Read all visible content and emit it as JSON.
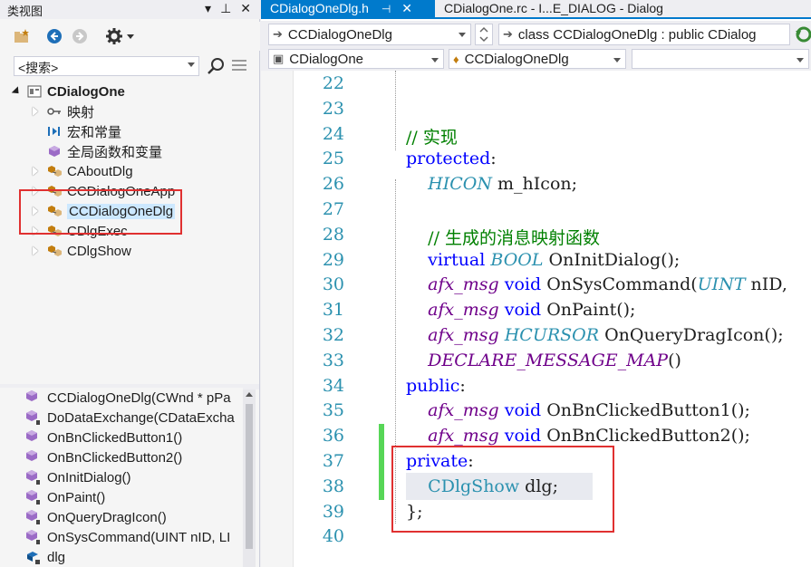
{
  "left_panel": {
    "title": "类视图",
    "title_buttons": {
      "dropdown": "▾",
      "pin": "⊥",
      "close": "✕"
    },
    "search": {
      "placeholder": "<搜索>"
    },
    "tree": [
      {
        "label": "CDialogOne",
        "bold": true,
        "icon": "project-icon",
        "expander": "open"
      },
      {
        "label": "映射",
        "icon": "key-icon",
        "expander": "closed"
      },
      {
        "label": "宏和常量",
        "icon": "macro-icon",
        "expander": ""
      },
      {
        "label": "全局函数和变量",
        "icon": "global-icon",
        "expander": ""
      },
      {
        "label": "CAboutDlg",
        "icon": "class-icon",
        "expander": "closed"
      },
      {
        "label": "CCDialogOneApp",
        "icon": "class-icon",
        "expander": "closed"
      },
      {
        "label": "CCDialogOneDlg",
        "icon": "class-icon",
        "expander": "closed",
        "selected": true
      },
      {
        "label": "CDlgExec",
        "icon": "class-icon",
        "expander": "closed"
      },
      {
        "label": "CDlgShow",
        "icon": "class-icon",
        "expander": "closed"
      }
    ],
    "members": [
      {
        "label": "CCDialogOneDlg(CWnd * pPa",
        "icon": "method-icon"
      },
      {
        "label": "DoDataExchange(CDataExcha",
        "icon": "method-protected-icon"
      },
      {
        "label": "OnBnClickedButton1()",
        "icon": "method-icon"
      },
      {
        "label": "OnBnClickedButton2()",
        "icon": "method-icon"
      },
      {
        "label": "OnInitDialog()",
        "icon": "method-protected-icon"
      },
      {
        "label": "OnPaint()",
        "icon": "method-protected-icon"
      },
      {
        "label": "OnQueryDragIcon()",
        "icon": "method-protected-icon"
      },
      {
        "label": "OnSysCommand(UINT nID, LI",
        "icon": "method-protected-icon"
      },
      {
        "label": "dlg",
        "icon": "field-private-icon"
      }
    ]
  },
  "editor": {
    "tabs": [
      {
        "label": "CDialogOneDlg.h",
        "active": true,
        "pin": "⊣",
        "close": "✕"
      },
      {
        "label": "CDialogOne.rc - I...E_DIALOG - Dialog",
        "active": false
      }
    ],
    "nav": {
      "scope_combo": "CCDialogOneDlg",
      "member_combo": "class CCDialogOneDlg : public CDialog",
      "project_combo": "CDialogOne",
      "class_combo": "CCDialogOneDlg",
      "empty_combo": ""
    },
    "lines": [
      {
        "num": "22",
        "tokens": []
      },
      {
        "num": "23",
        "tokens": []
      },
      {
        "num": "24",
        "tokens": [
          {
            "t": "// 实现",
            "c": "cm"
          }
        ]
      },
      {
        "num": "25",
        "tokens": [
          {
            "t": "protected",
            "c": "kw"
          },
          {
            "t": ":",
            "c": ""
          }
        ]
      },
      {
        "num": "26",
        "tokens": [
          {
            "t": "    ",
            "c": ""
          },
          {
            "t": "HICON",
            "c": "ty"
          },
          {
            "t": " m_hIcon;",
            "c": ""
          }
        ]
      },
      {
        "num": "27",
        "tokens": []
      },
      {
        "num": "28",
        "tokens": [
          {
            "t": "    ",
            "c": ""
          },
          {
            "t": "// 生成的消息映射函数",
            "c": "cm"
          }
        ]
      },
      {
        "num": "29",
        "tokens": [
          {
            "t": "    ",
            "c": ""
          },
          {
            "t": "virtual",
            "c": "kw"
          },
          {
            "t": " ",
            "c": ""
          },
          {
            "t": "BOOL",
            "c": "ty"
          },
          {
            "t": " OnInitDialog();",
            "c": ""
          }
        ]
      },
      {
        "num": "30",
        "tokens": [
          {
            "t": "    ",
            "c": ""
          },
          {
            "t": "afx_msg",
            "c": "mac"
          },
          {
            "t": " ",
            "c": ""
          },
          {
            "t": "void",
            "c": "kw"
          },
          {
            "t": " OnSysCommand(",
            "c": ""
          },
          {
            "t": "UINT",
            "c": "ty"
          },
          {
            "t": " nID,",
            "c": ""
          }
        ]
      },
      {
        "num": "31",
        "tokens": [
          {
            "t": "    ",
            "c": ""
          },
          {
            "t": "afx_msg",
            "c": "mac"
          },
          {
            "t": " ",
            "c": ""
          },
          {
            "t": "void",
            "c": "kw"
          },
          {
            "t": " OnPaint();",
            "c": ""
          }
        ]
      },
      {
        "num": "32",
        "tokens": [
          {
            "t": "    ",
            "c": ""
          },
          {
            "t": "afx_msg",
            "c": "mac"
          },
          {
            "t": " ",
            "c": ""
          },
          {
            "t": "HCURSOR",
            "c": "ty"
          },
          {
            "t": " OnQueryDragIcon();",
            "c": ""
          }
        ]
      },
      {
        "num": "33",
        "tokens": [
          {
            "t": "    ",
            "c": ""
          },
          {
            "t": "DECLARE_MESSAGE_MAP",
            "c": "mac"
          },
          {
            "t": "()",
            "c": ""
          }
        ]
      },
      {
        "num": "34",
        "tokens": [
          {
            "t": "public",
            "c": "kw"
          },
          {
            "t": ":",
            "c": ""
          }
        ]
      },
      {
        "num": "35",
        "tokens": [
          {
            "t": "    ",
            "c": ""
          },
          {
            "t": "afx_msg",
            "c": "mac"
          },
          {
            "t": " ",
            "c": ""
          },
          {
            "t": "void",
            "c": "kw"
          },
          {
            "t": " OnBnClickedButton1();",
            "c": ""
          }
        ]
      },
      {
        "num": "36",
        "tokens": [
          {
            "t": "    ",
            "c": ""
          },
          {
            "t": "afx_msg",
            "c": "mac"
          },
          {
            "t": " ",
            "c": ""
          },
          {
            "t": "void",
            "c": "kw"
          },
          {
            "t": " OnBnClickedButton2();",
            "c": ""
          }
        ]
      },
      {
        "num": "37",
        "tokens": [
          {
            "t": "private",
            "c": "kw"
          },
          {
            "t": ":",
            "c": ""
          }
        ]
      },
      {
        "num": "38",
        "tokens": [
          {
            "t": "    ",
            "c": ""
          },
          {
            "t": "CDlgShow",
            "c": "cls"
          },
          {
            "t": " dlg;",
            "c": ""
          }
        ]
      },
      {
        "num": "39",
        "tokens": [
          {
            "t": "};",
            "c": ""
          }
        ]
      },
      {
        "num": "40",
        "tokens": []
      }
    ]
  },
  "colors": {
    "accent": "#007acc",
    "keyword": "#0000ff",
    "type": "#2b91af",
    "macro": "#6f008a",
    "comment": "#008000",
    "highlight_box": "#e03030",
    "change_bar": "#57d657"
  }
}
